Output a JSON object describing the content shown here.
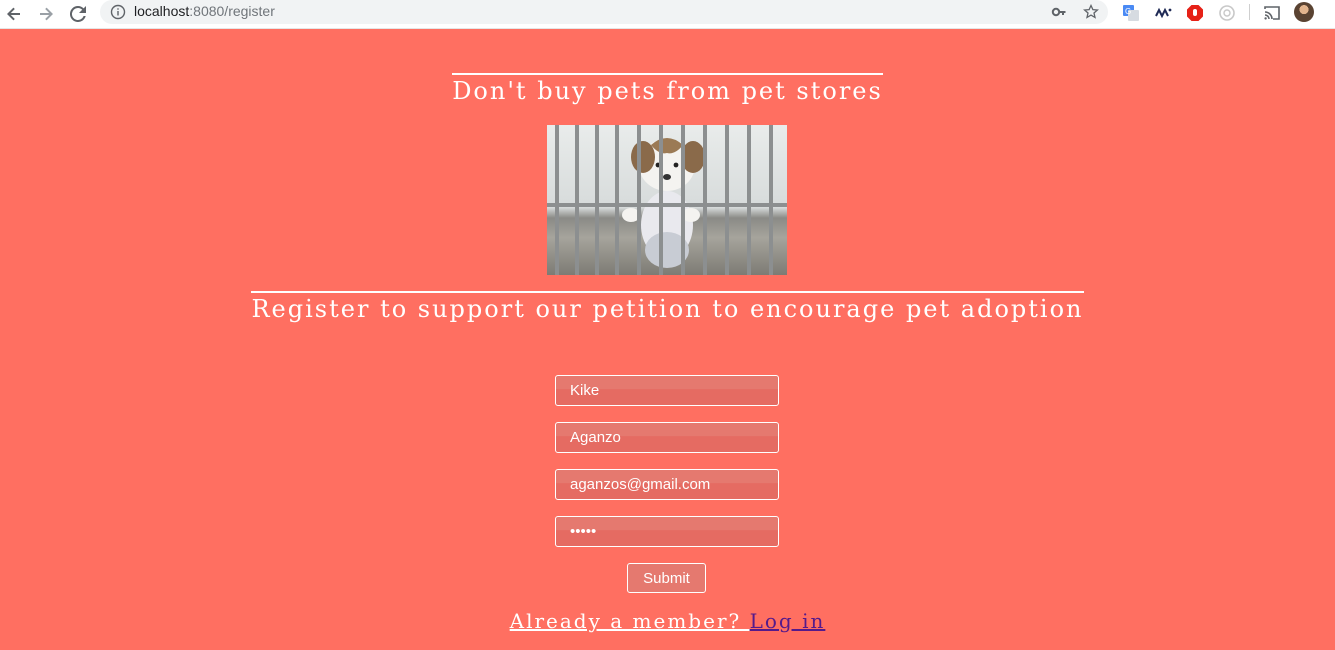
{
  "browser": {
    "url_host": "localhost",
    "url_rest": ":8080/register",
    "icons": [
      "back-arrow-icon",
      "forward-arrow-icon",
      "reload-icon",
      "info-icon",
      "key-icon",
      "star-icon",
      "translate-extension-icon",
      "extension-icon",
      "adblock-extension-icon",
      "extension-icon",
      "cast-icon",
      "avatar"
    ]
  },
  "page": {
    "background": "#ff6f61",
    "heading_top": "Don't buy pets from pet stores",
    "image_alt": "puppy behind cage bars",
    "heading_bottom": "Register to support our petition to encourage pet adoption",
    "form": {
      "first_name_value": "Kike",
      "last_name_value": "Aganzo",
      "email_value": "aganzos@gmail.com",
      "password_value": "12345",
      "submit_label": "Submit"
    },
    "login_prompt": "Already a member? ",
    "login_link": "Log in"
  }
}
